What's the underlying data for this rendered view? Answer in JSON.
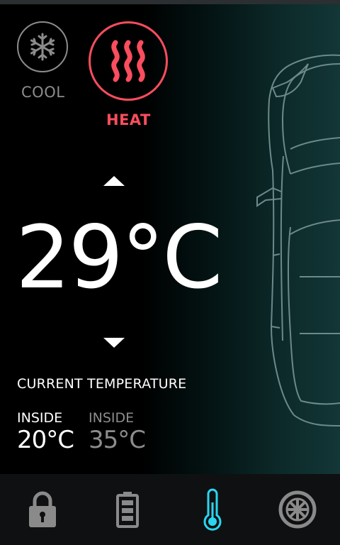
{
  "modes": {
    "cool": {
      "label": "COOL",
      "icon": "snowflake-icon",
      "color": "#8c8c8c"
    },
    "heat": {
      "label": "HEAT",
      "icon": "heat-waves-icon",
      "color": "#fa4d5e",
      "active": true
    }
  },
  "setpoint": {
    "value": "29°C"
  },
  "current": {
    "title": "CURRENT TEMPERATURE",
    "readings": [
      {
        "label": "INSIDE",
        "value": "20°C"
      },
      {
        "label": "INSIDE",
        "value": "35°C"
      }
    ]
  },
  "nav": {
    "items": [
      {
        "name": "lock",
        "icon": "lock-icon"
      },
      {
        "name": "battery",
        "icon": "battery-icon"
      },
      {
        "name": "climate",
        "icon": "thermometer-icon",
        "active": true,
        "color": "#29d6f0"
      },
      {
        "name": "wheel",
        "icon": "wheel-icon"
      }
    ]
  }
}
